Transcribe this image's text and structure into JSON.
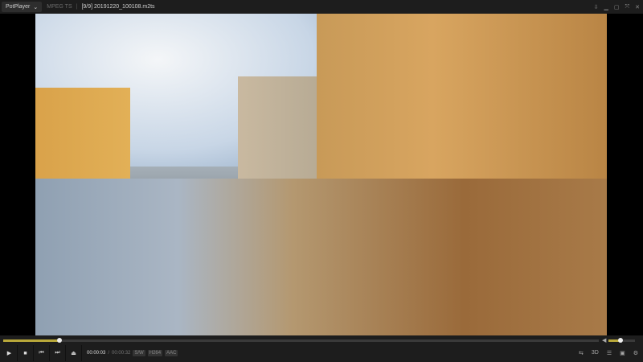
{
  "titlebar": {
    "app": "PotPlayer",
    "format": "MPEG TS",
    "file": "[9/9] 20191220_100108.m2ts"
  },
  "window_buttons": [
    "pin-icon",
    "minimize-icon",
    "maximize-icon",
    "fullscreen-icon",
    "close-icon"
  ],
  "playback": {
    "current": "00:00:03",
    "separator": "/",
    "duration": "00:00:32",
    "progress": 0.094,
    "volume": 0.45,
    "tags": [
      "S/W",
      "H264",
      "AAC"
    ]
  },
  "colors": {
    "accent": "#b9a83a",
    "bar": "#1d1d1d"
  }
}
